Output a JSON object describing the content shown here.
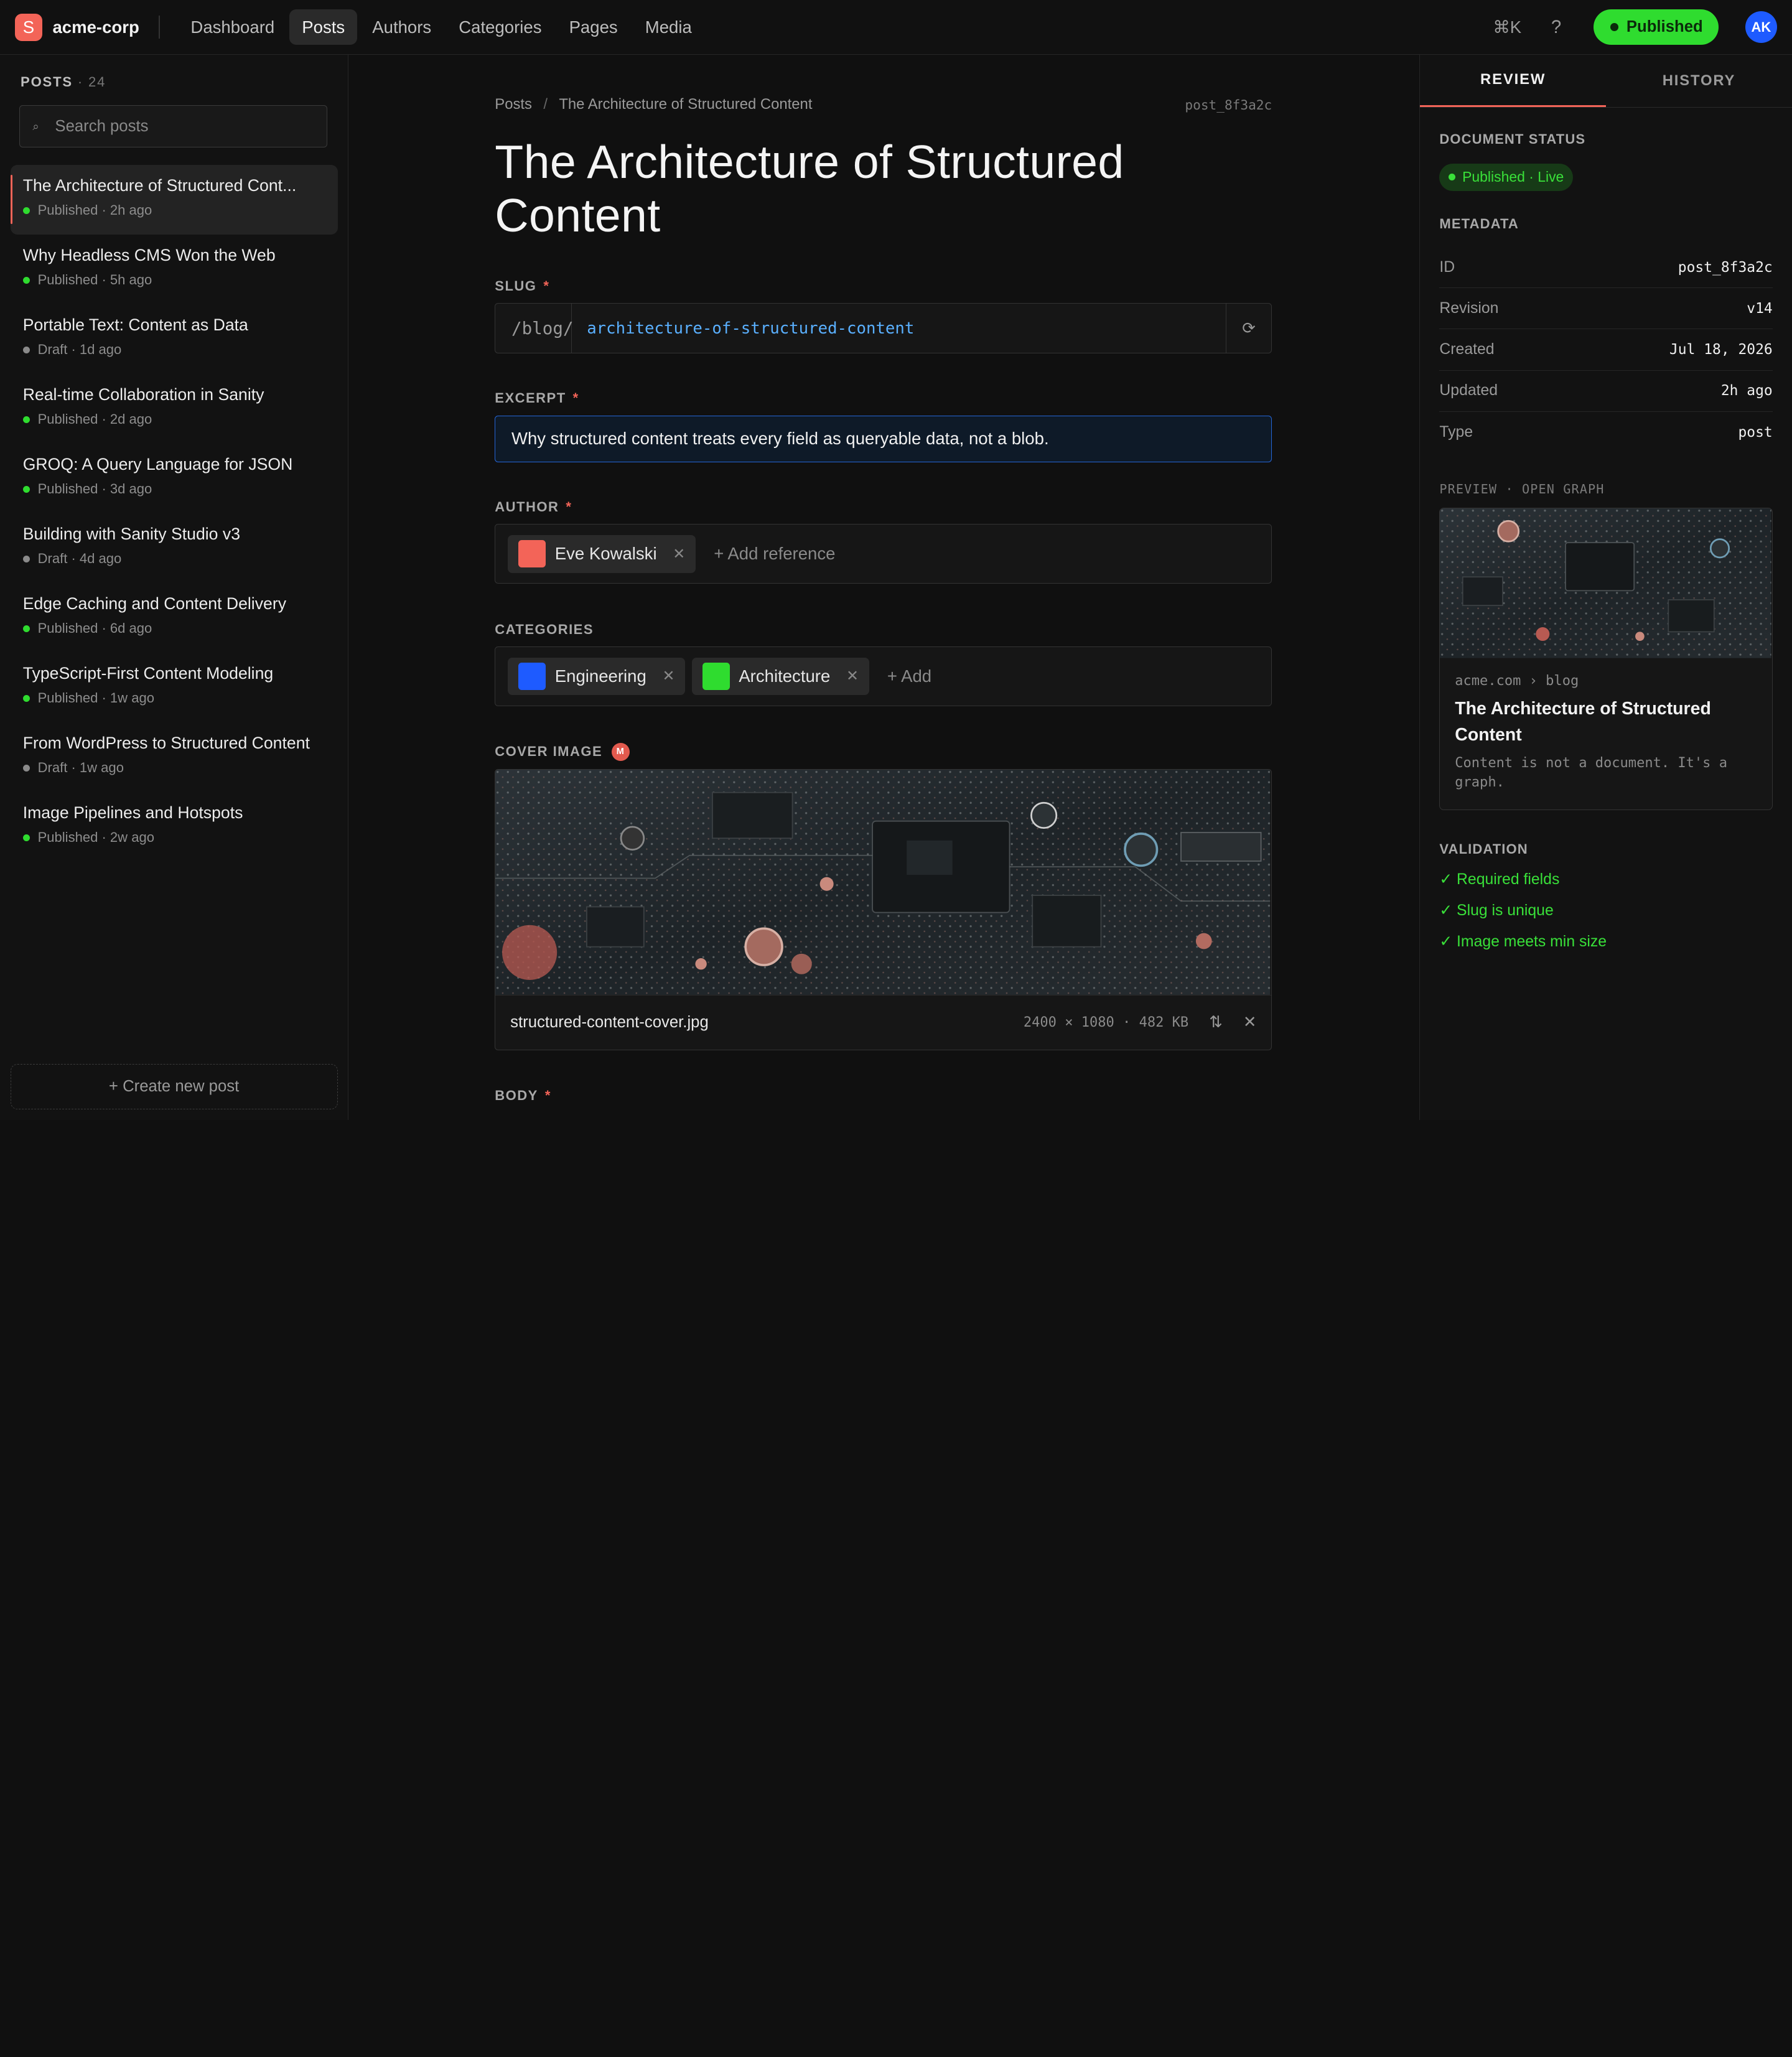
{
  "nav": {
    "logo_letter": "S",
    "workspace": "acme-corp",
    "items": [
      "Dashboard",
      "Posts",
      "Authors",
      "Categories",
      "Pages",
      "Media"
    ],
    "shortcut": "⌘K",
    "help": "?",
    "publish_label": "Published",
    "avatar_initials": "AK",
    "colors": {
      "brand": "#f36458",
      "publish": "#2fdc2f",
      "avatar": "#1e5bff"
    }
  },
  "sidebar": {
    "heading": "POSTS",
    "count": "· 24",
    "search_placeholder": "Search posts",
    "search_icon": "search-icon",
    "posts": [
      {
        "title": "The Architecture of Structured Cont...",
        "meta": "Published · 2h ago",
        "status": "live"
      },
      {
        "title": "Why Headless CMS Won the Web",
        "meta": "Published · 5h ago",
        "status": "live"
      },
      {
        "title": "Portable Text: Content as Data",
        "meta": "Draft · 1d ago",
        "status": "draft"
      },
      {
        "title": "Real-time Collaboration in Sanity",
        "meta": "Published · 2d ago",
        "status": "live"
      },
      {
        "title": "GROQ: A Query Language for JSON",
        "meta": "Published · 3d ago",
        "status": "live"
      },
      {
        "title": "Building with Sanity Studio v3",
        "meta": "Draft · 4d ago",
        "status": "draft"
      },
      {
        "title": "Edge Caching and Content Delivery",
        "meta": "Published · 6d ago",
        "status": "live"
      },
      {
        "title": "TypeScript-First Content Modeling",
        "meta": "Published · 1w ago",
        "status": "live"
      },
      {
        "title": "From WordPress to Structured Content",
        "meta": "Draft · 1w ago",
        "status": "draft"
      },
      {
        "title": "Image Pipelines and Hotspots",
        "meta": "Published · 2w ago",
        "status": "live"
      }
    ],
    "create_label": "+ Create new post"
  },
  "editor": {
    "breadcrumb": [
      "Posts",
      "The Architecture of Structured Content"
    ],
    "breadcrumb_sep": "/",
    "doc_id": "post_8f3a2c",
    "title": "The Architecture of Structured Content",
    "slug": {
      "label": "SLUG",
      "prefix": "/blog/",
      "value": "architecture-of-structured-content",
      "regen_icon": "⟳"
    },
    "excerpt": {
      "label": "EXCERPT",
      "value": "Why structured content treats every field as queryable data, not a blob."
    },
    "author": {
      "label": "AUTHOR",
      "name": "Eve Kowalski",
      "color": "#f36458",
      "add_label": "+ Add reference"
    },
    "categories": {
      "label": "CATEGORIES",
      "items": [
        {
          "name": "Engineering",
          "color": "#1e5bff"
        },
        {
          "name": "Architecture",
          "color": "#2fdc2f"
        }
      ],
      "add_label": "+ Add"
    },
    "cover": {
      "label": "COVER IMAGE",
      "badge": "M",
      "filename": "structured-content-cover.jpg",
      "dims": "2400 × 1080 · 482 KB"
    },
    "body_label": "BODY",
    "required_mark": "*",
    "remove_icon": "✕"
  },
  "panel": {
    "tabs": [
      "REVIEW",
      "HISTORY"
    ],
    "status_label": "DOCUMENT STATUS",
    "status_value": "Published · Live",
    "metadata_label": "METADATA",
    "metadata": [
      {
        "k": "ID",
        "v": "post_8f3a2c"
      },
      {
        "k": "Revision",
        "v": "v14"
      },
      {
        "k": "Created",
        "v": "Jul 18, 2026"
      },
      {
        "k": "Updated",
        "v": "2h ago"
      },
      {
        "k": "Type",
        "v": "post"
      }
    ],
    "preview_label": "PREVIEW · OPEN GRAPH",
    "og": {
      "url": "acme.com › blog",
      "title": "The Architecture of Structured Content",
      "desc": "Content is not a document. It's a graph."
    },
    "validation_label": "VALIDATION",
    "validation": [
      "✓ Required fields",
      "✓ Slug is unique",
      "✓ Image meets min size"
    ]
  }
}
